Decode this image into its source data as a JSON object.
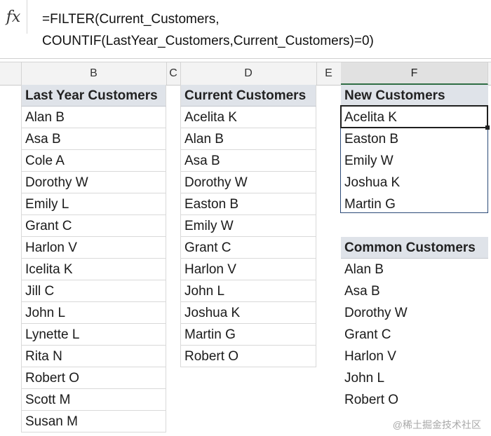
{
  "formula_bar": {
    "fx_label": "fx",
    "formula_line1": "=FILTER(Current_Customers,",
    "formula_line2": "COUNTIF(LastYear_Customers,Current_Customers)=0)"
  },
  "column_headers": [
    "B",
    "C",
    "D",
    "E",
    "F"
  ],
  "last_year": {
    "header": "Last Year Customers",
    "rows": [
      "Alan B",
      "Asa B",
      "Cole A",
      "Dorothy W",
      "Emily L",
      "Grant C",
      "Harlon V",
      "Icelita K",
      "Jill C",
      "John L",
      "Lynette L",
      "Rita N",
      "Robert O",
      "Scott M",
      "Susan M"
    ]
  },
  "current": {
    "header": "Current Customers",
    "rows": [
      "Acelita K",
      "Alan B",
      "Asa B",
      "Dorothy W",
      "Easton B",
      "Emily W",
      "Grant C",
      "Harlon V",
      "John L",
      "Joshua K",
      "Martin G",
      "Robert O"
    ]
  },
  "new_customers": {
    "header": "New Customers",
    "rows": [
      "Acelita K",
      "Easton B",
      "Emily W",
      "Joshua K",
      "Martin G"
    ]
  },
  "common_customers": {
    "header": "Common Customers",
    "rows": [
      "Alan B",
      "Asa B",
      "Dorothy W",
      "Grant C",
      "Harlon V",
      "John L",
      "Robert O"
    ]
  },
  "watermark": "@稀土掘金技术社区",
  "colors": {
    "header_fill": "#dfe3e9",
    "spill_border": "#2c4a78",
    "selected_column_fill": "#e1e1e1"
  }
}
